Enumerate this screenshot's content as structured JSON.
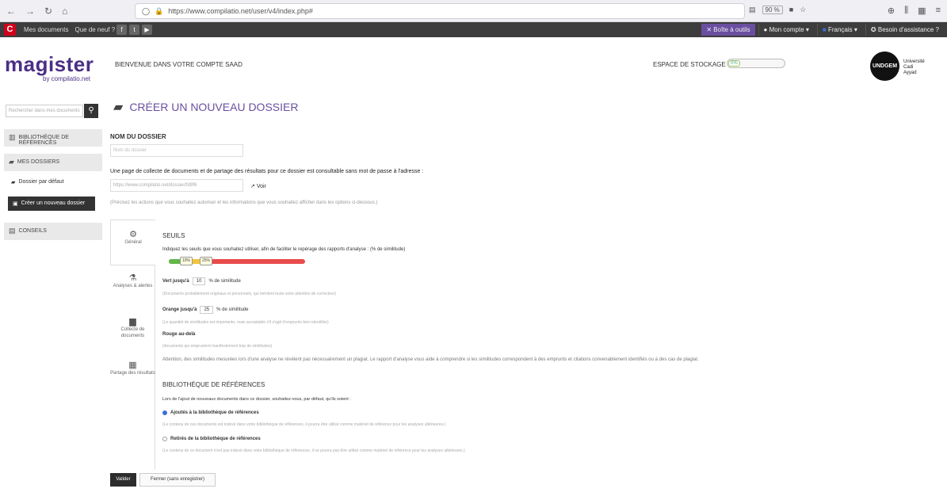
{
  "browser": {
    "url": "https://www.compilatio.net/user/v4/index.php#",
    "zoom": "90 %"
  },
  "topbar": {
    "links": [
      "Mes documents",
      "Que de neuf ?"
    ],
    "boite": "Boîte à outils",
    "compte": "Mon compte",
    "langue": "Français",
    "aide": "Besoin d'assistance ?"
  },
  "brand": {
    "name": "magister",
    "sub": "by compilatio.net"
  },
  "header": {
    "welcome": "Bienvenue dans votre compte SAAD",
    "storage_label": "Espace de stockage",
    "storage_value": "0%",
    "univ_logo": "UNDGEM",
    "univ_text": [
      "Université",
      "Cadi",
      "Ayyad"
    ]
  },
  "sidebar": {
    "search_placeholder": "Rechercher dans mes documents",
    "biblio": "Bibliothèque de références",
    "dossiers": "Mes dossiers",
    "default_folder": "Dossier par défaut",
    "new_folder": "Créer un nouveau dossier",
    "conseils": "Conseils"
  },
  "main": {
    "title": "Créer un nouveau dossier",
    "nom_label": "Nom du dossier",
    "nom_placeholder": "Nom du dossier",
    "desc_url": "Une page de collecte de documents et de partage des résultats pour ce dossier est consultable sans mot de passe à l'adresse :",
    "url_value": "https://www.compilatio.net/dossier/fd9f6",
    "voir": "Voir",
    "precise": "(Précisez les actions que vous souhaitez autoriser et les informations que vous souhaitez afficher dans les options ci-dessous.)"
  },
  "tabs": [
    {
      "label": "Général",
      "icon": "gear-icon"
    },
    {
      "label": "Analyses & alertes",
      "icon": "flask-icon"
    },
    {
      "label": "Collecte de documents",
      "icon": "inbox-icon"
    },
    {
      "label": "Partage des résultats",
      "icon": "share-icon"
    }
  ],
  "seuils": {
    "title": "Seuils",
    "desc": "Indiquez les seuils que vous souhaitez utiliser, afin de faciliter le repérage des rapports d'analyse : (% de similitude)",
    "mark1": "10%",
    "mark2": "25%",
    "vert_label": "Vert jusqu'à",
    "vert_value": "10",
    "orange_label": "Orange jusqu'à",
    "orange_value": "25",
    "unit": "% de similitude",
    "vert_hint": "(Documents probablement originaux et personnels, qui méritent toute votre attention de correcteur)",
    "orange_hint": "(Le quantité de similitudes est importante, mais acceptable s'il s'agit d'emprunts bien identifiés)",
    "rouge_label": "Rouge au-delà",
    "rouge_hint": "(documents qui empruntent manifestement trop de similitudes)",
    "attention": "Attention, des similitudes mesurées lors d'une analyse ne révèlent pas nécessairement un plagiat. Le rapport d'analyse vous aide à comprendre si les similitudes correspondent à des emprunts et citations convenablement identifiés ou à des cas de plagiat."
  },
  "biblio": {
    "title": "Bibliothèque de références",
    "desc": "Lors de l'ajout de nouveaux documents dans ce dossier, souhaitez-vous, par défaut, qu'ils soient :",
    "opt1": "Ajoutés à la bibliothèque de références",
    "opt1_hint": "(Le contenu de ces documents est indexé dans votre bibliothèque de références, il pourra être utilisé comme matériel de référence pour les analyses ultérieures.)",
    "opt2": "Retirés de la bibliothèque de références",
    "opt2_hint": "(Le contenu de ce document n'est pas indexé dans votre bibliothèque de références, il ne pourra pas être utilisé comme matériel de référence pour les analyses ultérieures.)"
  },
  "buttons": {
    "valider": "Valider",
    "fermer": "Fermer (sans enregistrer)"
  }
}
